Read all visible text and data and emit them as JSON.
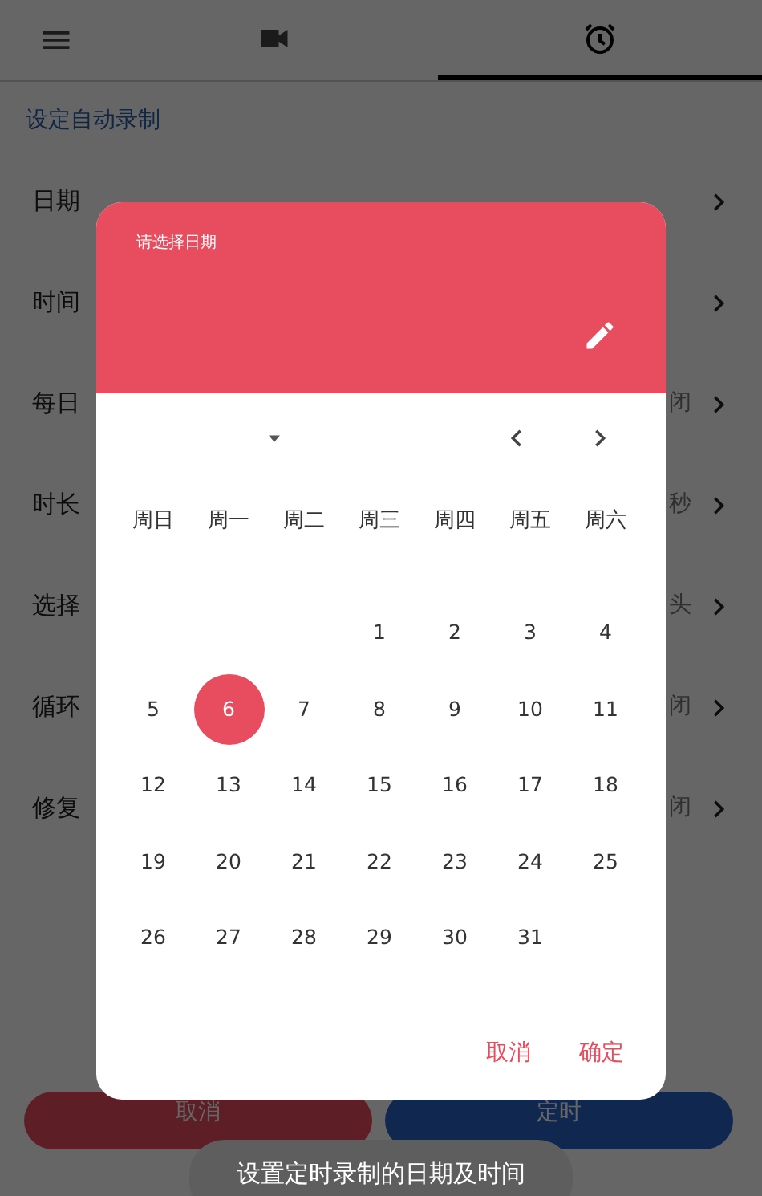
{
  "tabs": [
    {
      "kind": "video",
      "selected": false
    },
    {
      "kind": "alarm",
      "selected": true
    }
  ],
  "section_title": "设定自动录制",
  "settings": [
    {
      "label": "日期"
    },
    {
      "label": "时间"
    },
    {
      "label": "每日",
      "value": "闭"
    },
    {
      "label": "时长",
      "value": "秒"
    },
    {
      "label": "选择",
      "value": "头"
    },
    {
      "label": "循环",
      "value": "闭"
    },
    {
      "label": "修复",
      "value": "闭"
    }
  ],
  "page_buttons": [
    {
      "label": "取消",
      "kind": "cancel"
    },
    {
      "label": "定时",
      "kind": "confirm"
    }
  ],
  "date_picker": {
    "title": "请选择日期",
    "weekdays": [
      "周日",
      "周一",
      "周二",
      "周三",
      "周四",
      "周五",
      "周六"
    ],
    "weeks": [
      {
        "days": [
          {
            "kind": "blank"
          },
          {
            "kind": "blank"
          },
          {
            "kind": "blank"
          },
          {
            "label": "1",
            "selected": false
          },
          {
            "label": "2",
            "selected": false
          },
          {
            "label": "3",
            "selected": false
          },
          {
            "label": "4",
            "selected": false
          }
        ]
      },
      {
        "days": [
          {
            "label": "5",
            "selected": false
          },
          {
            "label": "6",
            "selected": true
          },
          {
            "label": "7",
            "selected": false
          },
          {
            "label": "8",
            "selected": false
          },
          {
            "label": "9",
            "selected": false
          },
          {
            "label": "10",
            "selected": false
          },
          {
            "label": "11",
            "selected": false
          }
        ]
      },
      {
        "days": [
          {
            "label": "12",
            "selected": false
          },
          {
            "label": "13",
            "selected": false
          },
          {
            "label": "14",
            "selected": false
          },
          {
            "label": "15",
            "selected": false
          },
          {
            "label": "16",
            "selected": false
          },
          {
            "label": "17",
            "selected": false
          },
          {
            "label": "18",
            "selected": false
          }
        ]
      },
      {
        "days": [
          {
            "label": "19",
            "selected": false
          },
          {
            "label": "20",
            "selected": false
          },
          {
            "label": "21",
            "selected": false
          },
          {
            "label": "22",
            "selected": false
          },
          {
            "label": "23",
            "selected": false
          },
          {
            "label": "24",
            "selected": false
          },
          {
            "label": "25",
            "selected": false
          }
        ]
      },
      {
        "days": [
          {
            "label": "26",
            "selected": false
          },
          {
            "label": "27",
            "selected": false
          },
          {
            "label": "28",
            "selected": false
          },
          {
            "label": "29",
            "selected": false
          },
          {
            "label": "30",
            "selected": false
          },
          {
            "label": "31",
            "selected": false
          }
        ]
      }
    ],
    "actions": [
      "取消",
      "确定"
    ]
  },
  "toast": "设置定时录制的日期及时间"
}
